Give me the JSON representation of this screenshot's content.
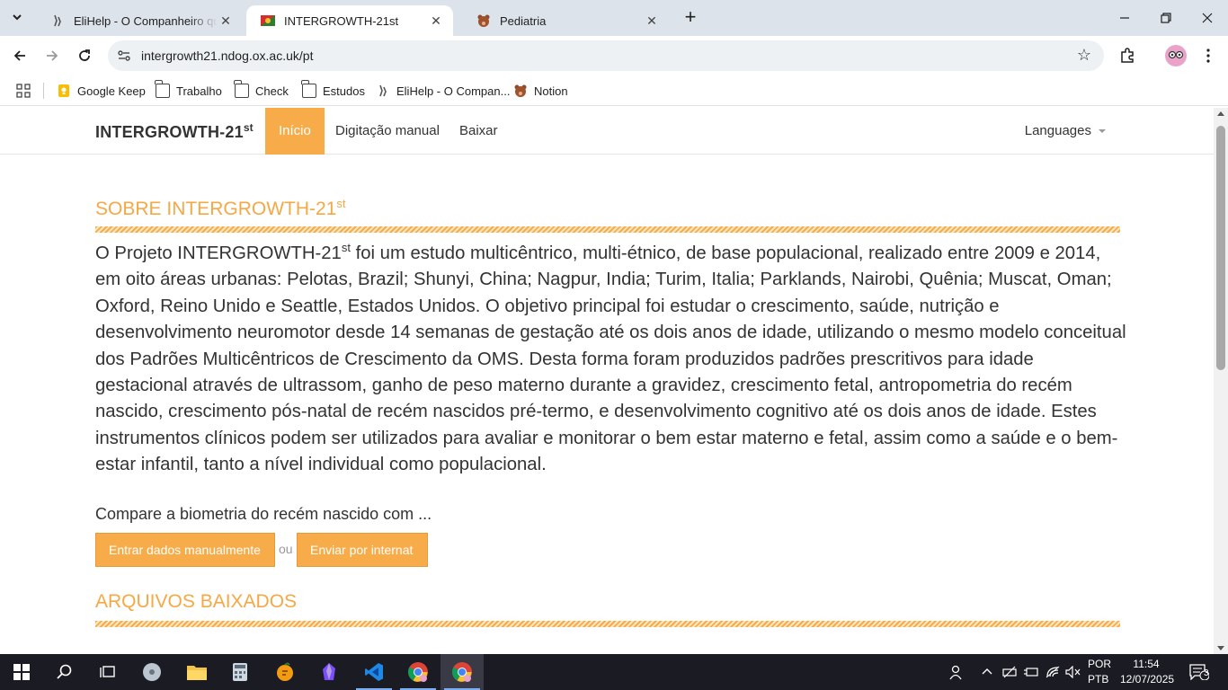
{
  "browser": {
    "tabs": [
      {
        "title": "EliHelp - O Companheiro que Te",
        "active": false
      },
      {
        "title": "INTERGROWTH-21st",
        "active": true
      },
      {
        "title": "Pediatria",
        "active": false
      }
    ],
    "url": "intergrowth21.ndog.ox.ac.uk/pt",
    "bookmarks": [
      {
        "label": "Google Keep",
        "icon": "google-keep-icon"
      },
      {
        "label": "Trabalho",
        "icon": "folder-icon"
      },
      {
        "label": "Check",
        "icon": "folder-icon"
      },
      {
        "label": "Estudos",
        "icon": "folder-icon"
      },
      {
        "label": "EliHelp - O Compan...",
        "icon": "elihelp-icon"
      },
      {
        "label": "Notion",
        "icon": "notion-bear-icon"
      }
    ]
  },
  "site": {
    "brand": "INTERGROWTH-21",
    "brand_sup": "st",
    "nav": [
      "Início",
      "Digitação manual",
      "Baixar"
    ],
    "languages": "Languages",
    "about_title": "SOBRE INTERGROWTH-21",
    "about_sup": "st",
    "lead_start": "O Projeto INTERGROWTH-21",
    "lead_sup": "st",
    "lead_rest": " foi um estudo multicêntrico, multi-étnico, de base populacional, realizado entre 2009 e 2014, em oito áreas urbanas: Pelotas, Brazil; Shunyi, China; Nagpur, India; Turim, Italia; Parklands, Nairobi, Quênia; Muscat, Oman; Oxford, Reino Unido e Seattle, Estados Unidos. O objetivo principal foi estudar o crescimento, saúde, nutrição e desenvolvimento neuromotor desde 14 semanas de gestação até os dois anos de idade, utilizando o mesmo modelo conceitual dos Padrões Multicêntricos de Crescimento da OMS. Desta forma foram produzidos padrões prescritivos para idade gestacional através de ultrassom, ganho de peso materno durante a gravidez, crescimento fetal, antropometria do recém nascido, crescimento pós-natal de recém nascidos pré-termo, e desenvolvimento cognitivo até os dois anos de idade. Estes instrumentos clínicos podem ser utilizados para avaliar e monitorar o bem estar materno e fetal, assim como a saúde e o bem-estar infantil, tanto a nível individual como populacional.",
    "compare": "Compare a biometria do recém nascido com ...",
    "btn_manual": "Entrar dados manualmente",
    "or": "ou",
    "btn_internet": "Enviar por internat",
    "downloads_title": "ARQUIVOS BAIXADOS",
    "accent_color": "#f8ac49"
  },
  "taskbar": {
    "lang1": "POR",
    "lang2": "PTB",
    "time": "11:54",
    "date": "12/07/2025",
    "notifications": "3"
  }
}
